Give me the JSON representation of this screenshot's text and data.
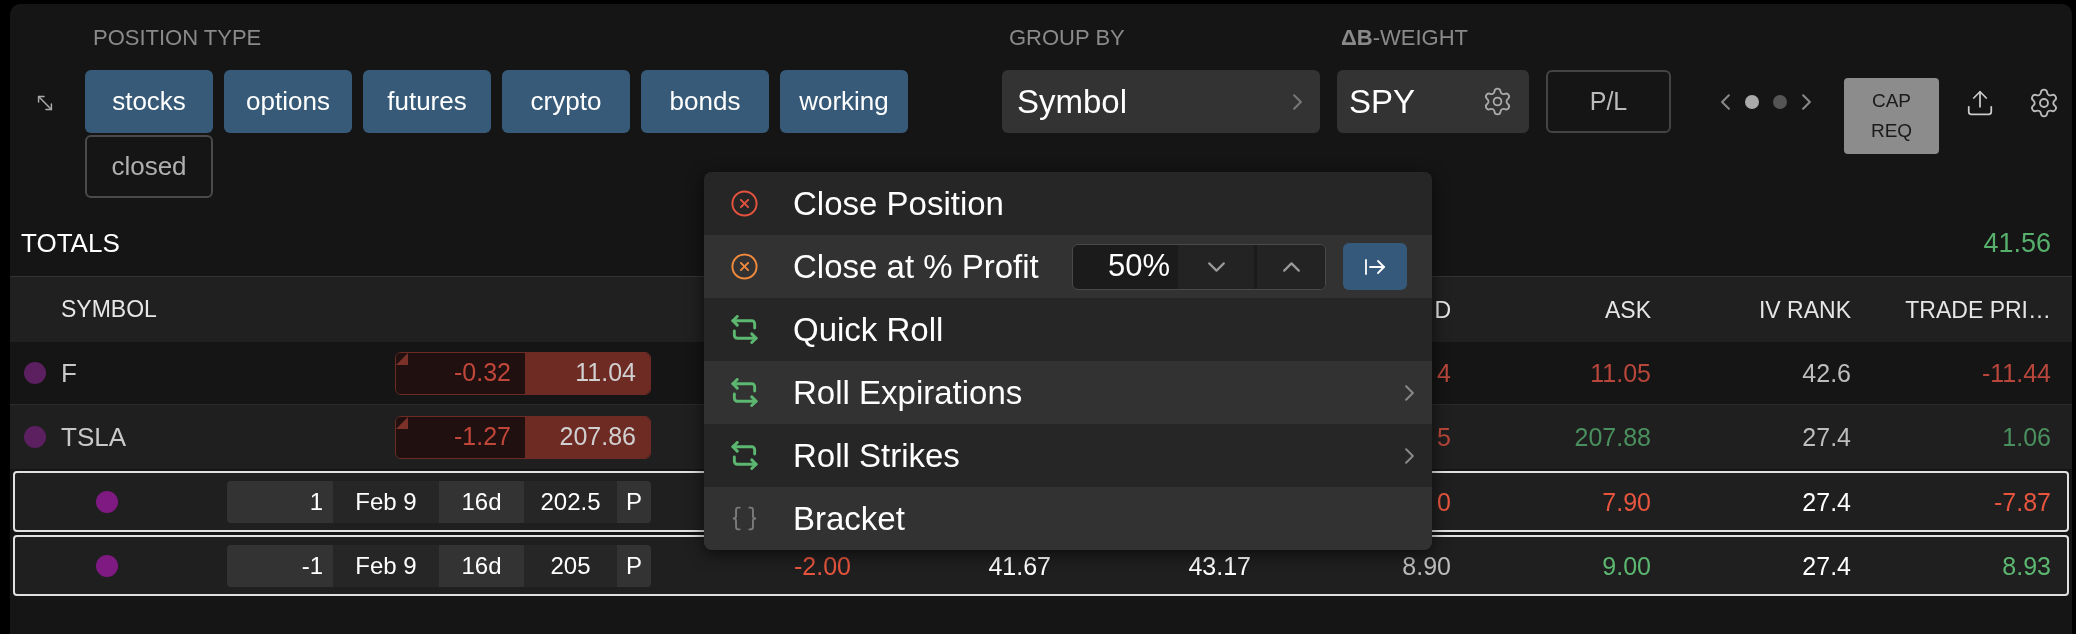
{
  "position_type": {
    "label": "POSITION TYPE",
    "chips": [
      {
        "label": "stocks",
        "selected": true
      },
      {
        "label": "options",
        "selected": true
      },
      {
        "label": "futures",
        "selected": true
      },
      {
        "label": "crypto",
        "selected": true
      },
      {
        "label": "bonds",
        "selected": true
      },
      {
        "label": "working",
        "selected": true
      },
      {
        "label": "closed",
        "selected": false
      }
    ]
  },
  "group_by": {
    "label": "GROUP BY",
    "value": "Symbol"
  },
  "beta_weight": {
    "label": "**ΔB**-WEIGHT",
    "value": "SPY"
  },
  "pl_button": "P/L",
  "pager": {
    "pages": [
      {
        "selected": true
      },
      {
        "selected": false
      }
    ]
  },
  "cap_req_button": "CAP REQ",
  "totals": {
    "label": "TOTALS",
    "value": "41.56"
  },
  "table": {
    "symbol_header": "SYMBOL",
    "columns": [
      null,
      null,
      null,
      "D",
      "ASK",
      "IV RANK",
      "TRADE PRI…"
    ],
    "rows": [
      {
        "symbol": "F",
        "color": "#5c1f5f",
        "selected": false,
        "expanded": false,
        "quote": {
          "change": "-0.32",
          "price": "11.04"
        },
        "cells": [
          null,
          null,
          null,
          {
            "text": "4",
            "color": "#b8463a"
          },
          {
            "text": "11.05",
            "color": "#b8463a"
          },
          {
            "text": "42.6",
            "color": "#bdbdbd"
          },
          {
            "text": "-11.44",
            "color": "#b8463a"
          }
        ]
      },
      {
        "symbol": "TSLA",
        "color": "#5c1f5f",
        "selected": false,
        "expanded": true,
        "quote": {
          "change": "-1.27",
          "price": "207.86"
        },
        "cells": [
          null,
          null,
          null,
          {
            "text": "5",
            "color": "#b8463a"
          },
          {
            "text": "207.88",
            "color": "#4a8f5e"
          },
          {
            "text": "27.4",
            "color": "#bdbdbd"
          },
          {
            "text": "1.06",
            "color": "#4a8f5e"
          }
        ],
        "children": [
          {
            "color": "#7f1a82",
            "selected": true,
            "contract": {
              "quantity": "1",
              "expiration": "Feb 9",
              "days": "16d",
              "strike": "202.5",
              "type": "P"
            },
            "cells": [
              null,
              null,
              null,
              {
                "text": "0",
                "color": "#e8553f"
              },
              {
                "text": "7.90",
                "color": "#e8553f"
              },
              {
                "text": "27.4",
                "color": "#ffffff"
              },
              {
                "text": "-7.87",
                "color": "#e8553f"
              }
            ]
          },
          {
            "color": "#7f1a82",
            "selected": true,
            "contract": {
              "quantity": "-1",
              "expiration": "Feb 9",
              "days": "16d",
              "strike": "205",
              "type": "P"
            },
            "cells": [
              {
                "text": "-2.00",
                "color": "#e8553f"
              },
              {
                "text": "41.67",
                "color": "#ffffff"
              },
              {
                "text": "43.17",
                "color": "#ffffff"
              },
              {
                "text": "8.90",
                "color": "#bdbdbd"
              },
              {
                "text": "9.00",
                "color": "#5cb870"
              },
              {
                "text": "27.4",
                "color": "#ffffff"
              },
              {
                "text": "8.93",
                "color": "#5cb870"
              }
            ]
          }
        ]
      }
    ]
  },
  "context_menu": {
    "items": [
      {
        "kind": "close",
        "label": "Close Position",
        "color": "#e5533f",
        "submenu": false
      },
      {
        "kind": "close",
        "label": "Close at % Profit",
        "color": "#f08a3c",
        "submenu": false,
        "stepper": {
          "value": "50%"
        }
      },
      {
        "kind": "roll",
        "label": "Quick Roll",
        "color": "#5cb870",
        "submenu": false
      },
      {
        "kind": "roll",
        "label": "Roll Expirations",
        "color": "#5cb870",
        "submenu": true
      },
      {
        "kind": "roll",
        "label": "Roll Strikes",
        "color": "#5cb870",
        "submenu": true
      },
      {
        "kind": "bracket",
        "label": "Bracket",
        "color": "#7a7a7a",
        "submenu": false
      }
    ]
  }
}
